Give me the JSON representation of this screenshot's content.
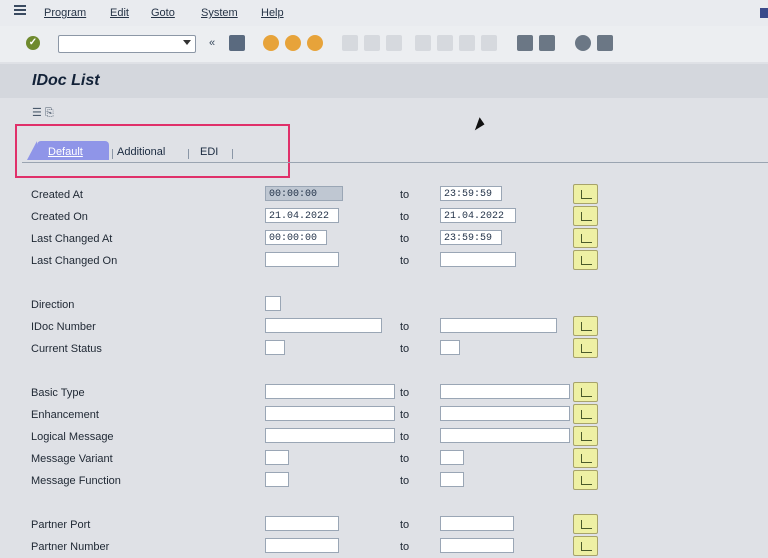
{
  "menubar": {
    "items": [
      "Program",
      "Edit",
      "Goto",
      "System",
      "Help"
    ]
  },
  "title": "IDoc List",
  "tabs": {
    "items": [
      "Default",
      "Additional",
      "EDI"
    ]
  },
  "form": {
    "to_label": "to",
    "fields": [
      {
        "label": "Created At",
        "from": "00:00:00",
        "to": "23:59:59"
      },
      {
        "label": "Created On",
        "from": "21.04.2022",
        "to": "21.04.2022"
      },
      {
        "label": "Last Changed At",
        "from": "00:00:00",
        "to": "23:59:59"
      },
      {
        "label": "Last Changed On",
        "from": "",
        "to": ""
      },
      {
        "label": "Direction",
        "from": "",
        "to": null
      },
      {
        "label": "IDoc Number",
        "from": "",
        "to": ""
      },
      {
        "label": "Current Status",
        "from": "",
        "to": ""
      },
      {
        "label": "Basic Type",
        "from": "",
        "to": ""
      },
      {
        "label": "Enhancement",
        "from": "",
        "to": ""
      },
      {
        "label": "Logical Message",
        "from": "",
        "to": ""
      },
      {
        "label": "Message Variant",
        "from": "",
        "to": ""
      },
      {
        "label": "Message Function",
        "from": "",
        "to": ""
      },
      {
        "label": "Partner Port",
        "from": "",
        "to": ""
      },
      {
        "label": "Partner Number",
        "from": "",
        "to": ""
      }
    ]
  },
  "icons": {
    "menu": "menu-icon",
    "ok": "checkmark-icon",
    "save": "save-icon",
    "multiple_selection": "multiple-selection-icon"
  },
  "colors": {
    "active_tab": "#8f95e8",
    "highlight_box": "#e0306a",
    "multi_select_button": "#eef0a4"
  }
}
